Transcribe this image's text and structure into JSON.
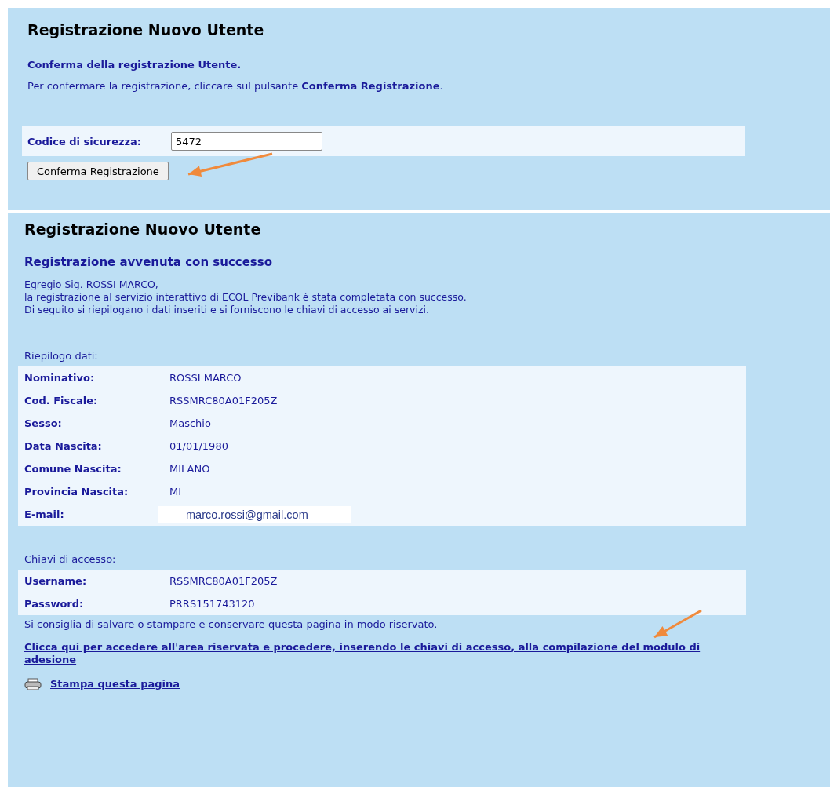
{
  "confirm_panel": {
    "title": "Registrazione Nuovo Utente",
    "subtitle": "Conferma della registrazione Utente.",
    "instruction": "Per confermare la registrazione, cliccare sul pulsante **Conferma Registrazione**.",
    "security_code": {
      "label": "Codice di sicurezza:",
      "value": "5472"
    },
    "button": "Conferma Registrazione"
  },
  "success_panel": {
    "title": "Registrazione Nuovo Utente",
    "subtitle": "Registrazione avvenuta con successo",
    "message": [
      "Egregio Sig. ROSSI MARCO,",
      "la registrazione al servizio interattivo di ECOL Previbank è stata completata con successo.",
      "Di seguito si riepilogano i dati inseriti e si forniscono le chiavi di accesso ai servizi."
    ],
    "summary_heading": "Riepilogo dati:",
    "summary": [
      {
        "label": "Nominativo:",
        "value": "ROSSI MARCO"
      },
      {
        "label": "Cod. Fiscale:",
        "value": "RSSMRC80A01F205Z"
      },
      {
        "label": "Sesso:",
        "value": "Maschio"
      },
      {
        "label": "Data Nascita:",
        "value": "01/01/1980"
      },
      {
        "label": "Comune Nascita:",
        "value": "MILANO"
      },
      {
        "label": "Provincia Nascita:",
        "value": "MI"
      },
      {
        "label": "E-mail:",
        "value": "marco.rossi@gmail.com",
        "kind": "pasted"
      }
    ],
    "keys_heading": "Chiavi di accesso:",
    "keys": [
      {
        "label": "Username:",
        "value": "RSSMRC80A01F205Z"
      },
      {
        "label": "Password:",
        "value": "PRRS151743120"
      }
    ],
    "advice": "Si consiglia di salvare o stampare e conservare questa pagina in modo riservato.",
    "area_link": "Clicca qui per accedere all'area riservata e procedere, inserendo le chiavi di accesso, alla compilazione del modulo di adesione",
    "print_link": "Stampa questa pagina"
  }
}
